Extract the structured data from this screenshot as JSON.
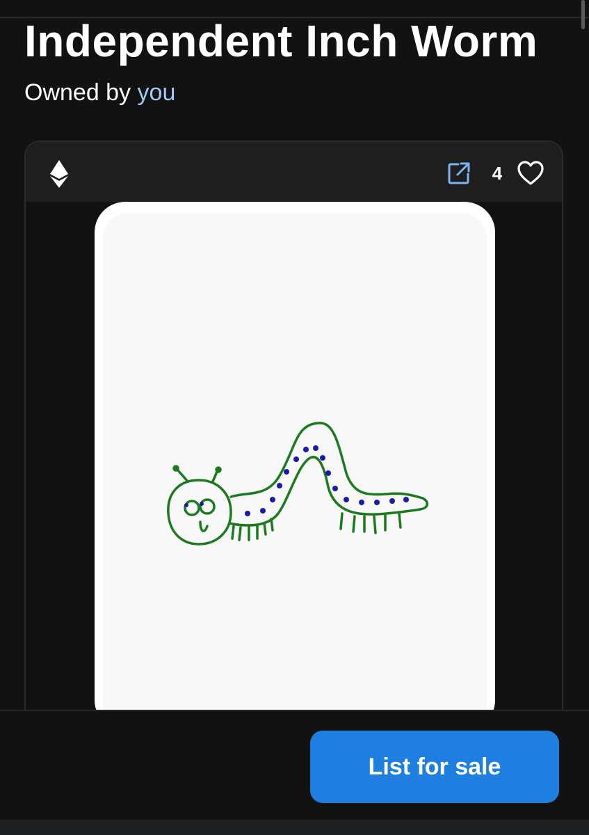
{
  "nft": {
    "title": "Independent Inch Worm",
    "owner_prefix": "Owned by",
    "owner_link": "you",
    "likes": "4"
  },
  "card_header": {
    "chain_icon": "ethereum-icon",
    "external_icon": "external-link-icon",
    "like_icon": "heart-outline-icon"
  },
  "actions": {
    "list_for_sale": "List for sale"
  },
  "colors": {
    "background": "#121212",
    "accent": "#1f7fe0",
    "owner_link": "#9ecbf7",
    "worm_outline": "#1b7a1e",
    "worm_spots": "#1a1aa6"
  }
}
